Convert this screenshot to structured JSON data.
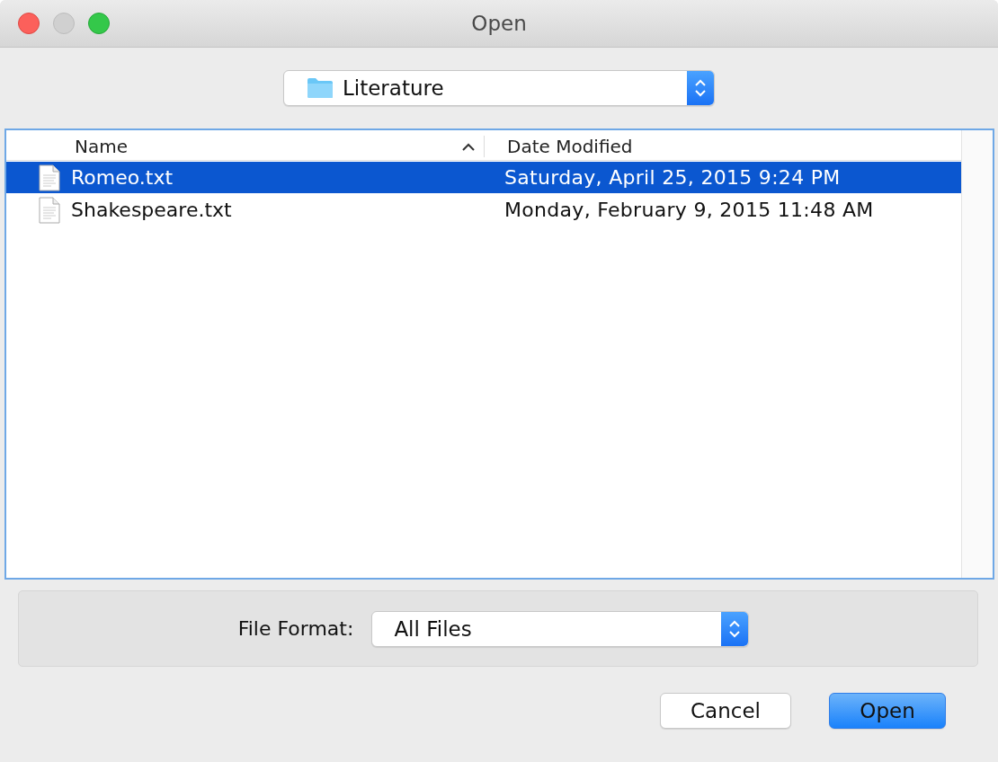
{
  "window": {
    "title": "Open"
  },
  "location": {
    "value": "Literature"
  },
  "table": {
    "columns": [
      {
        "label": "Name",
        "sorted": true
      },
      {
        "label": "Date Modified",
        "sorted": false
      }
    ],
    "rows": [
      {
        "name": "Romeo.txt",
        "date": "Saturday, April 25, 2015 9:24 PM",
        "selected": true
      },
      {
        "name": "Shakespeare.txt",
        "date": "Monday, February 9, 2015 11:48 AM",
        "selected": false
      }
    ]
  },
  "format": {
    "label": "File Format:",
    "value": "All Files"
  },
  "buttons": [
    {
      "label": "Cancel",
      "default": false
    },
    {
      "label": "Open",
      "default": true
    }
  ]
}
